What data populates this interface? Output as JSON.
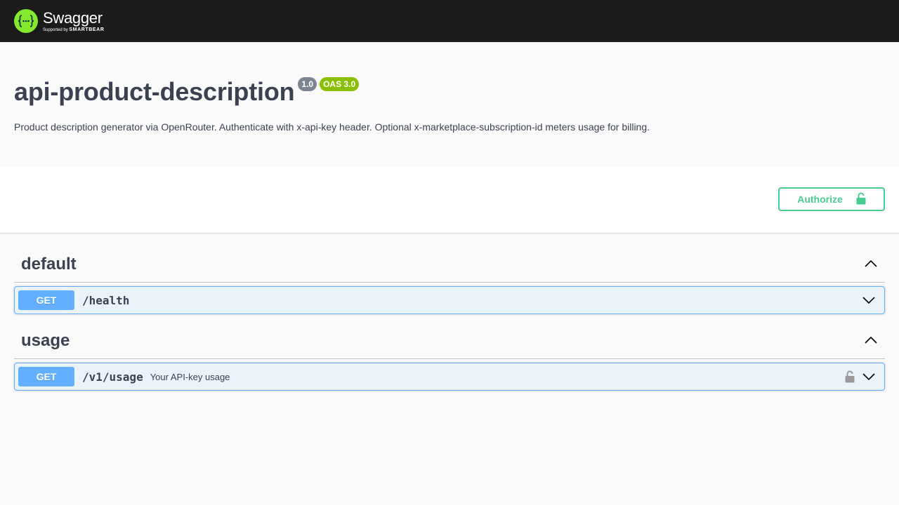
{
  "topbar": {
    "logo_name": "Swagger",
    "logo_sub_prefix": "Supported by",
    "logo_sub_brand": "SMARTBEAR",
    "logo_icon": "swagger-braces-icon"
  },
  "info": {
    "title": "api-product-description",
    "version": "1.0",
    "oas": "OAS 3.0",
    "description": "Product description generator via OpenRouter. Authenticate with x-api-key header. Optional x-marketplace-subscription-id meters usage for billing."
  },
  "auth": {
    "authorize_label": "Authorize",
    "icon": "unlocked-lock-icon"
  },
  "groups": [
    {
      "name": "default",
      "expanded": true,
      "operations": [
        {
          "method": "GET",
          "path": "/health",
          "summary": "",
          "locked": false
        }
      ]
    },
    {
      "name": "usage",
      "expanded": true,
      "operations": [
        {
          "method": "GET",
          "path": "/v1/usage",
          "summary": "Your API-key usage",
          "locked": true
        }
      ]
    }
  ],
  "colors": {
    "topbar_bg": "#1b1b1b",
    "logo_green": "#85ea2d",
    "get_blue": "#61affe",
    "authorize_green": "#49cc90",
    "version_badge": "#7d8492",
    "oas_badge": "#89bf04",
    "text": "#3b4151"
  }
}
